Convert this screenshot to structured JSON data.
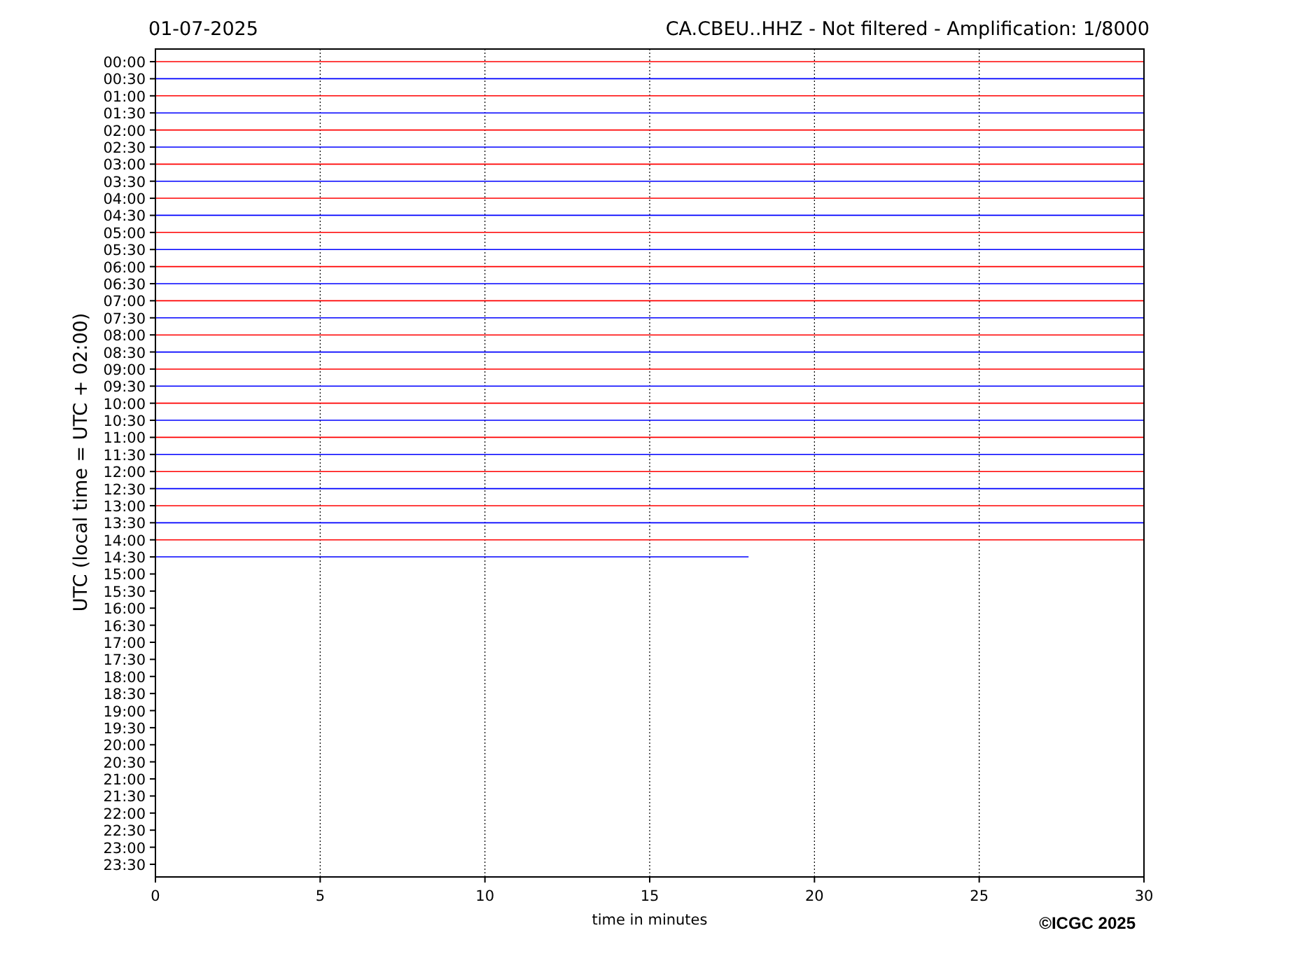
{
  "header": {
    "date": "01-07-2025",
    "title": "CA.CBEU..HHZ - Not filtered - Amplification: 1/8000"
  },
  "chart_data": {
    "type": "line",
    "xlabel": "time in minutes",
    "ylabel": "UTC (local time = UTC + 02:00)",
    "x": [
      0,
      18,
      30
    ],
    "grid": true,
    "xlim": [
      0,
      30
    ],
    "ylim": [
      23.87,
      -0.37
    ],
    "xticks": [
      0,
      5,
      10,
      15,
      20,
      25,
      30
    ],
    "yticks": [
      {
        "value": 0,
        "label": "00:00"
      },
      {
        "value": 0.5,
        "label": "00:30"
      },
      {
        "value": 1,
        "label": "01:00"
      },
      {
        "value": 1.5,
        "label": "01:30"
      },
      {
        "value": 2,
        "label": "02:00"
      },
      {
        "value": 2.5,
        "label": "02:30"
      },
      {
        "value": 3,
        "label": "03:00"
      },
      {
        "value": 3.5,
        "label": "03:30"
      },
      {
        "value": 4,
        "label": "04:00"
      },
      {
        "value": 4.5,
        "label": "04:30"
      },
      {
        "value": 5,
        "label": "05:00"
      },
      {
        "value": 5.5,
        "label": "05:30"
      },
      {
        "value": 6,
        "label": "06:00"
      },
      {
        "value": 6.5,
        "label": "06:30"
      },
      {
        "value": 7,
        "label": "07:00"
      },
      {
        "value": 7.5,
        "label": "07:30"
      },
      {
        "value": 8,
        "label": "08:00"
      },
      {
        "value": 8.5,
        "label": "08:30"
      },
      {
        "value": 9,
        "label": "09:00"
      },
      {
        "value": 9.5,
        "label": "09:30"
      },
      {
        "value": 10,
        "label": "10:00"
      },
      {
        "value": 10.5,
        "label": "10:30"
      },
      {
        "value": 11,
        "label": "11:00"
      },
      {
        "value": 11.5,
        "label": "11:30"
      },
      {
        "value": 12,
        "label": "12:00"
      },
      {
        "value": 12.5,
        "label": "12:30"
      },
      {
        "value": 13,
        "label": "13:00"
      },
      {
        "value": 13.5,
        "label": "13:30"
      },
      {
        "value": 14,
        "label": "14:00"
      },
      {
        "value": 14.5,
        "label": "14:30"
      },
      {
        "value": 15,
        "label": "15:00"
      },
      {
        "value": 15.5,
        "label": "15:30"
      },
      {
        "value": 16,
        "label": "16:00"
      },
      {
        "value": 16.5,
        "label": "16:30"
      },
      {
        "value": 17,
        "label": "17:00"
      },
      {
        "value": 17.5,
        "label": "17:30"
      },
      {
        "value": 18,
        "label": "18:00"
      },
      {
        "value": 18.5,
        "label": "18:30"
      },
      {
        "value": 19,
        "label": "19:00"
      },
      {
        "value": 19.5,
        "label": "19:30"
      },
      {
        "value": 20,
        "label": "20:00"
      },
      {
        "value": 20.5,
        "label": "20:30"
      },
      {
        "value": 21,
        "label": "21:00"
      },
      {
        "value": 21.5,
        "label": "21:30"
      },
      {
        "value": 22,
        "label": "22:00"
      },
      {
        "value": 22.5,
        "label": "22:30"
      },
      {
        "value": 23,
        "label": "23:00"
      },
      {
        "value": 23.5,
        "label": "23:30"
      }
    ],
    "series": [
      {
        "color": "#ff0000",
        "values": [
          0,
          0,
          0
        ]
      },
      {
        "color": "#0000ff",
        "values": [
          0.5,
          0.5,
          0.5
        ]
      },
      {
        "color": "#ff0000",
        "values": [
          1,
          1,
          1
        ]
      },
      {
        "color": "#0000ff",
        "values": [
          1.5,
          1.5,
          1.5
        ]
      },
      {
        "color": "#ff0000",
        "values": [
          2,
          2,
          2
        ]
      },
      {
        "color": "#0000ff",
        "values": [
          2.5,
          2.5,
          2.5
        ]
      },
      {
        "color": "#ff0000",
        "values": [
          3,
          3,
          3
        ]
      },
      {
        "color": "#0000ff",
        "values": [
          3.5,
          3.5,
          3.5
        ]
      },
      {
        "color": "#ff0000",
        "values": [
          4,
          4,
          4
        ]
      },
      {
        "color": "#0000ff",
        "values": [
          4.5,
          4.5,
          4.5
        ]
      },
      {
        "color": "#ff0000",
        "values": [
          5,
          5,
          5
        ]
      },
      {
        "color": "#0000ff",
        "values": [
          5.5,
          5.5,
          5.5
        ]
      },
      {
        "color": "#ff0000",
        "values": [
          6,
          6,
          6
        ]
      },
      {
        "color": "#0000ff",
        "values": [
          6.5,
          6.5,
          6.5
        ]
      },
      {
        "color": "#ff0000",
        "values": [
          7,
          7,
          7
        ]
      },
      {
        "color": "#0000ff",
        "values": [
          7.5,
          7.5,
          7.5
        ]
      },
      {
        "color": "#ff0000",
        "values": [
          8,
          8,
          8
        ]
      },
      {
        "color": "#0000ff",
        "values": [
          8.5,
          8.5,
          8.5
        ]
      },
      {
        "color": "#ff0000",
        "values": [
          9,
          9,
          9
        ]
      },
      {
        "color": "#0000ff",
        "values": [
          9.5,
          9.5,
          9.5
        ]
      },
      {
        "color": "#ff0000",
        "values": [
          10,
          10,
          10
        ]
      },
      {
        "color": "#0000ff",
        "values": [
          10.5,
          10.5,
          10.5
        ]
      },
      {
        "color": "#ff0000",
        "values": [
          11,
          11,
          11
        ]
      },
      {
        "color": "#0000ff",
        "values": [
          11.5,
          11.5,
          11.5
        ]
      },
      {
        "color": "#ff0000",
        "values": [
          12,
          12,
          12
        ]
      },
      {
        "color": "#0000ff",
        "values": [
          12.5,
          12.5,
          12.5
        ]
      },
      {
        "color": "#ff0000",
        "values": [
          13,
          13,
          13
        ]
      },
      {
        "color": "#0000ff",
        "values": [
          13.5,
          13.5,
          13.5
        ]
      },
      {
        "color": "#ff0000",
        "values": [
          14,
          14,
          14
        ]
      },
      {
        "color": "#0000ff",
        "values": [
          14.5,
          14.5,
          null
        ]
      }
    ]
  },
  "credit": "©ICGC 2025"
}
